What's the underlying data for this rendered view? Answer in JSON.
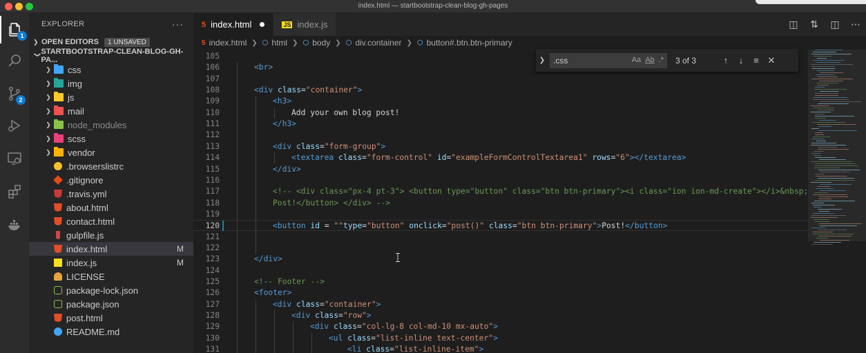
{
  "window": {
    "title": "index.html — startbootstrap-clean-blog-gh-pages"
  },
  "activity_bar": {
    "items": [
      {
        "name": "explorer",
        "badge": "1"
      },
      {
        "name": "search"
      },
      {
        "name": "source-control",
        "badge": "2"
      },
      {
        "name": "run-debug"
      },
      {
        "name": "remote-explorer"
      },
      {
        "name": "extensions"
      },
      {
        "name": "docker"
      }
    ]
  },
  "sidebar": {
    "title": "EXPLORER",
    "more": "···",
    "open_editors": {
      "label": "OPEN EDITORS",
      "badge": "1 UNSAVED"
    },
    "project": {
      "label": "STARTBOOTSTRAP-CLEAN-BLOG-GH-PA..."
    },
    "items": [
      {
        "label": "css",
        "kind": "folder",
        "color": "#42a5f5"
      },
      {
        "label": "img",
        "kind": "folder",
        "color": "#26a69a"
      },
      {
        "label": "js",
        "kind": "folder",
        "color": "#ffca28"
      },
      {
        "label": "mail",
        "kind": "folder",
        "color": "#ef5350"
      },
      {
        "label": "node_modules",
        "kind": "folder",
        "color": "#8bc34a",
        "dimmed": true
      },
      {
        "label": "scss",
        "kind": "folder",
        "color": "#ec407a"
      },
      {
        "label": "vendor",
        "kind": "folder",
        "color": "#ffb300"
      },
      {
        "label": ".browserslistrc",
        "kind": "file",
        "icon": "yellow-circle",
        "color": "#fbc02d"
      },
      {
        "label": ".gitignore",
        "kind": "file",
        "icon": "git-diamond",
        "color": "#e64a19"
      },
      {
        "label": ".travis.yml",
        "kind": "file",
        "icon": "travis",
        "color": "#cb3837"
      },
      {
        "label": "about.html",
        "kind": "file",
        "icon": "html5",
        "color": "#e44d26"
      },
      {
        "label": "contact.html",
        "kind": "file",
        "icon": "html5",
        "color": "#e44d26"
      },
      {
        "label": "gulpfile.js",
        "kind": "file",
        "icon": "gulp",
        "color": "#cf4647"
      },
      {
        "label": "index.html",
        "kind": "file",
        "icon": "html5",
        "color": "#e44d26",
        "status": "M",
        "selected": true
      },
      {
        "label": "index.js",
        "kind": "file",
        "icon": "js",
        "color": "#f7df1e",
        "status": "M"
      },
      {
        "label": "LICENSE",
        "kind": "file",
        "icon": "license",
        "color": "#e8a33d"
      },
      {
        "label": "package-lock.json",
        "kind": "file",
        "icon": "nodejs",
        "color": "#8bc34a"
      },
      {
        "label": "package.json",
        "kind": "file",
        "icon": "nodejs",
        "color": "#8bc34a"
      },
      {
        "label": "post.html",
        "kind": "file",
        "icon": "html5",
        "color": "#e44d26"
      },
      {
        "label": "README.md",
        "kind": "file",
        "icon": "info",
        "color": "#42a5f5"
      }
    ]
  },
  "tabs": [
    {
      "label": "index.html",
      "icon": "html5",
      "color": "#e44d26",
      "active": true,
      "dirty": true
    },
    {
      "label": "index.js",
      "icon": "js",
      "color": "#f7df1e",
      "active": false
    }
  ],
  "breadcrumb": [
    {
      "label": "index.html",
      "icon": "html5"
    },
    {
      "label": "html",
      "icon": "element"
    },
    {
      "label": "body",
      "icon": "element"
    },
    {
      "label": "div.container",
      "icon": "element"
    },
    {
      "label": "button#.btn.btn-primary",
      "icon": "element"
    }
  ],
  "find_widget": {
    "value": ".css",
    "count": "3 of 3",
    "options": [
      "Aa",
      "Ab",
      ".*"
    ]
  },
  "editor": {
    "current_line": 120,
    "lines": [
      {
        "n": 105,
        "indent": 0,
        "tokens": []
      },
      {
        "n": 106,
        "indent": 1,
        "tokens": [
          [
            "tg",
            "<br>"
          ]
        ]
      },
      {
        "n": 107,
        "indent": 0,
        "tokens": []
      },
      {
        "n": 108,
        "indent": 1,
        "tokens": [
          [
            "tg",
            "<div "
          ],
          [
            "at",
            "class"
          ],
          [
            "tx",
            "="
          ],
          [
            "st",
            "\"container\""
          ],
          [
            "tg",
            ">"
          ]
        ]
      },
      {
        "n": 109,
        "indent": 2,
        "tokens": [
          [
            "tg",
            "<h3>"
          ]
        ]
      },
      {
        "n": 110,
        "indent": 3,
        "tokens": [
          [
            "tx",
            "Add your own blog post!"
          ]
        ]
      },
      {
        "n": 111,
        "indent": 2,
        "tokens": [
          [
            "tg",
            "</h3>"
          ]
        ]
      },
      {
        "n": 112,
        "indent": 0,
        "tokens": []
      },
      {
        "n": 113,
        "indent": 2,
        "tokens": [
          [
            "tg",
            "<div "
          ],
          [
            "at",
            "class"
          ],
          [
            "tx",
            "="
          ],
          [
            "st",
            "\"form-group\""
          ],
          [
            "tg",
            ">"
          ]
        ]
      },
      {
        "n": 114,
        "indent": 3,
        "tokens": [
          [
            "tg",
            "<textarea "
          ],
          [
            "at",
            "class"
          ],
          [
            "tx",
            "="
          ],
          [
            "st",
            "\"form-control\" "
          ],
          [
            "at",
            "id"
          ],
          [
            "tx",
            "="
          ],
          [
            "st",
            "\"exampleFormControlTextarea1\" "
          ],
          [
            "at",
            "rows"
          ],
          [
            "tx",
            "="
          ],
          [
            "st",
            "\"6\""
          ],
          [
            "tg",
            "></textarea>"
          ]
        ]
      },
      {
        "n": 115,
        "indent": 2,
        "tokens": [
          [
            "tg",
            "</div>"
          ]
        ]
      },
      {
        "n": 116,
        "indent": 0,
        "tokens": []
      },
      {
        "n": 117,
        "indent": 2,
        "tokens": [
          [
            "cm",
            "<!-- <div class=\"px-4 pt-3\"> <button type=\"button\" class=\"btn btn-primary\"><i class=\"ion ion-md-create\"></i>&nbsp;"
          ]
        ]
      },
      {
        "n": 118,
        "indent": 2,
        "tokens": [
          [
            "cm",
            "Post!</button> </div> -->"
          ]
        ]
      },
      {
        "n": 119,
        "indent": 0,
        "tokens": []
      },
      {
        "n": 120,
        "indent": 2,
        "tokens": [
          [
            "tg",
            "<button "
          ],
          [
            "at",
            "id"
          ],
          [
            "tx",
            " = "
          ],
          [
            "st",
            "\"\""
          ],
          [
            "at",
            "type"
          ],
          [
            "tx",
            "="
          ],
          [
            "st",
            "\"button\" "
          ],
          [
            "at",
            "onclick"
          ],
          [
            "tx",
            "="
          ],
          [
            "st",
            "\"post()\" "
          ],
          [
            "at",
            "class"
          ],
          [
            "tx",
            "="
          ],
          [
            "st",
            "\"btn btn-primary\""
          ],
          [
            "tg",
            ">"
          ],
          [
            "tx",
            "Post!"
          ],
          [
            "tg",
            "</button>"
          ]
        ]
      },
      {
        "n": 121,
        "indent": 0,
        "tokens": []
      },
      {
        "n": 122,
        "indent": 0,
        "tokens": []
      },
      {
        "n": 123,
        "indent": 1,
        "tokens": [
          [
            "tg",
            "</div>"
          ]
        ]
      },
      {
        "n": 124,
        "indent": 0,
        "tokens": []
      },
      {
        "n": 125,
        "indent": 1,
        "tokens": [
          [
            "cm",
            "<!-- Footer -->"
          ]
        ]
      },
      {
        "n": 126,
        "indent": 1,
        "tokens": [
          [
            "tg",
            "<footer>"
          ]
        ]
      },
      {
        "n": 127,
        "indent": 2,
        "tokens": [
          [
            "tg",
            "<div "
          ],
          [
            "at",
            "class"
          ],
          [
            "tx",
            "="
          ],
          [
            "st",
            "\"container\""
          ],
          [
            "tg",
            ">"
          ]
        ]
      },
      {
        "n": 128,
        "indent": 3,
        "tokens": [
          [
            "tg",
            "<div "
          ],
          [
            "at",
            "class"
          ],
          [
            "tx",
            "="
          ],
          [
            "st",
            "\"row\""
          ],
          [
            "tg",
            ">"
          ]
        ]
      },
      {
        "n": 129,
        "indent": 4,
        "tokens": [
          [
            "tg",
            "<div "
          ],
          [
            "at",
            "class"
          ],
          [
            "tx",
            "="
          ],
          [
            "st",
            "\"col-lg-8 col-md-10 mx-auto\""
          ],
          [
            "tg",
            ">"
          ]
        ]
      },
      {
        "n": 130,
        "indent": 5,
        "tokens": [
          [
            "tg",
            "<ul "
          ],
          [
            "at",
            "class"
          ],
          [
            "tx",
            "="
          ],
          [
            "st",
            "\"list-inline text-center\""
          ],
          [
            "tg",
            ">"
          ]
        ]
      },
      {
        "n": 131,
        "indent": 6,
        "tokens": [
          [
            "tg",
            "<li "
          ],
          [
            "at",
            "class"
          ],
          [
            "tx",
            "="
          ],
          [
            "st",
            "\"list-inline-item\""
          ],
          [
            "tg",
            ">"
          ]
        ]
      }
    ]
  }
}
